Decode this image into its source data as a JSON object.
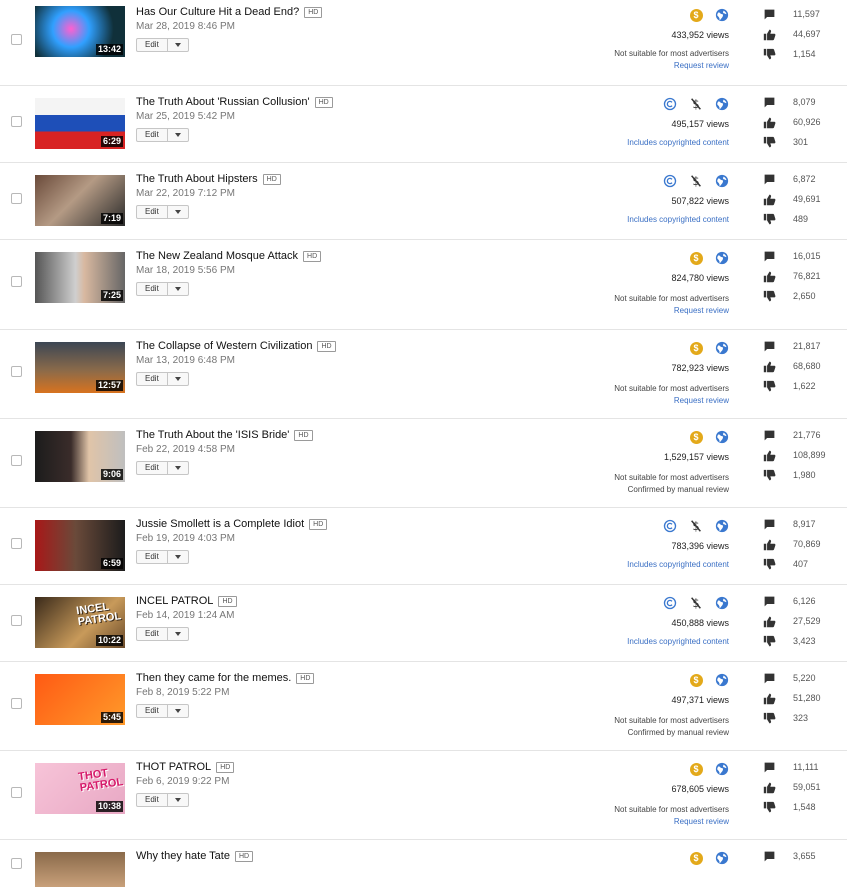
{
  "labels": {
    "edit": "Edit",
    "hd": "HD"
  },
  "colors": {
    "link": "#3a6fc4",
    "coin": "#e3a91a",
    "icon": "#333333"
  },
  "videos": [
    {
      "title": "Has Our Culture Hit a Dead End?",
      "date": "Mar 28, 2019 8:46 PM",
      "duration": "13:42",
      "monetization": "dollar",
      "views": "433,952 views",
      "status_line1": "Not suitable for most advertisers",
      "status_line2": "Request review",
      "comments": "11,597",
      "likes": "44,697",
      "dislikes": "1,154"
    },
    {
      "title": "The Truth About 'Russian Collusion'",
      "date": "Mar 25, 2019 5:42 PM",
      "duration": "6:29",
      "monetization": "copyright",
      "views": "495,157 views",
      "status_line1": "Includes copyrighted content",
      "comments": "8,079",
      "likes": "60,926",
      "dislikes": "301"
    },
    {
      "title": "The Truth About Hipsters",
      "date": "Mar 22, 2019 7:12 PM",
      "duration": "7:19",
      "monetization": "copyright",
      "views": "507,822 views",
      "status_line1": "Includes copyrighted content",
      "comments": "6,872",
      "likes": "49,691",
      "dislikes": "489"
    },
    {
      "title": "The New Zealand Mosque Attack",
      "date": "Mar 18, 2019 5:56 PM",
      "duration": "7:25",
      "monetization": "dollar",
      "views": "824,780 views",
      "status_line1": "Not suitable for most advertisers",
      "status_line2": "Request review",
      "comments": "16,015",
      "likes": "76,821",
      "dislikes": "2,650"
    },
    {
      "title": "The Collapse of Western Civilization",
      "date": "Mar 13, 2019 6:48 PM",
      "duration": "12:57",
      "monetization": "dollar",
      "views": "782,923 views",
      "status_line1": "Not suitable for most advertisers",
      "status_line2": "Request review",
      "comments": "21,817",
      "likes": "68,680",
      "dislikes": "1,622"
    },
    {
      "title": "The Truth About the 'ISIS Bride'",
      "date": "Feb 22, 2019 4:58 PM",
      "duration": "9:06",
      "monetization": "dollar",
      "views": "1,529,157 views",
      "status_line1": "Not suitable for most advertisers",
      "status_line2": "Confirmed by manual review",
      "comments": "21,776",
      "likes": "108,899",
      "dislikes": "1,980"
    },
    {
      "title": "Jussie Smollett is a Complete Idiot",
      "date": "Feb 19, 2019 4:03 PM",
      "duration": "6:59",
      "monetization": "copyright",
      "views": "783,396 views",
      "status_line1": "Includes copyrighted content",
      "comments": "8,917",
      "likes": "70,869",
      "dislikes": "407"
    },
    {
      "title": "INCEL PATROL",
      "date": "Feb 14, 2019 1:24 AM",
      "duration": "10:22",
      "thumb_text": "INCEL PATROL",
      "monetization": "copyright",
      "views": "450,888 views",
      "status_line1": "Includes copyrighted content",
      "comments": "6,126",
      "likes": "27,529",
      "dislikes": "3,423"
    },
    {
      "title": "Then they came for the memes.",
      "date": "Feb 8, 2019 5:22 PM",
      "duration": "5:45",
      "monetization": "dollar",
      "views": "497,371 views",
      "status_line1": "Not suitable for most advertisers",
      "status_line2": "Confirmed by manual review",
      "comments": "5,220",
      "likes": "51,280",
      "dislikes": "323"
    },
    {
      "title": "THOT PATROL",
      "date": "Feb 6, 2019 9:22 PM",
      "duration": "10:38",
      "thumb_text": "THOT PATROL",
      "monetization": "dollar",
      "views": "678,605 views",
      "status_line1": "Not suitable for most advertisers",
      "status_line2": "Request review",
      "comments": "11,111",
      "likes": "59,051",
      "dislikes": "1,548"
    },
    {
      "title": "Why they hate Tate",
      "monetization": "dollar",
      "comments": "3,655"
    }
  ]
}
